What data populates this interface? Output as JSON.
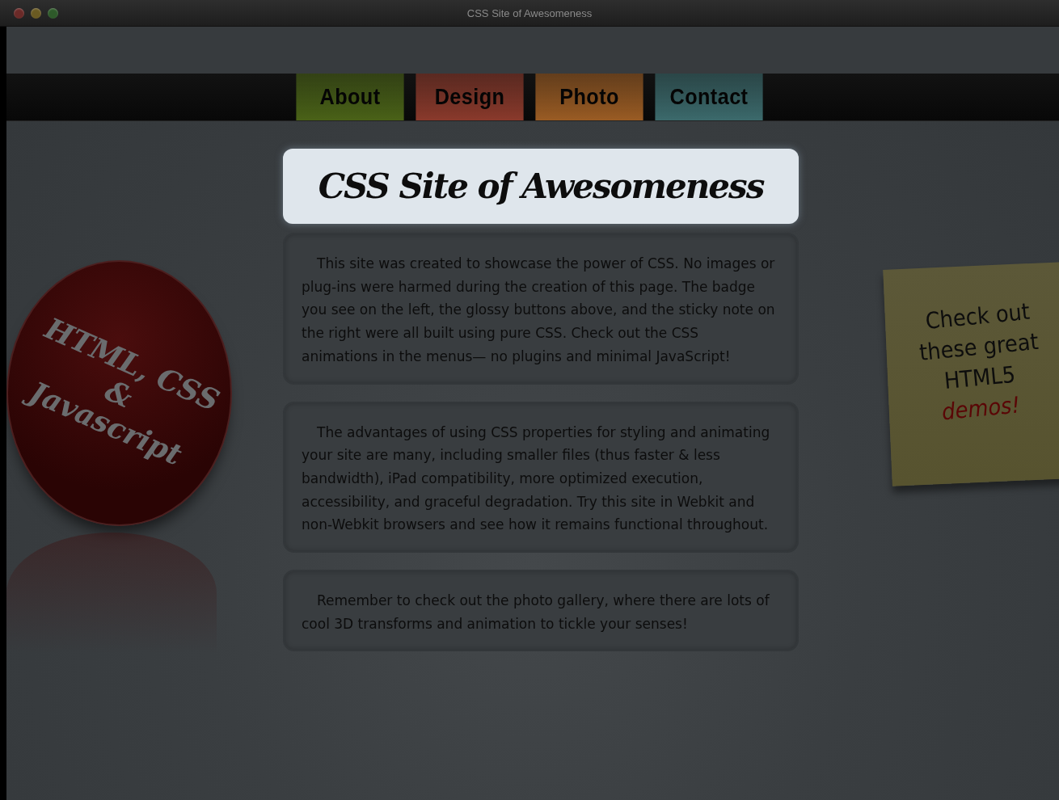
{
  "window": {
    "title": "CSS Site of Awesomeness"
  },
  "nav": [
    {
      "label": "About",
      "color": "#4a6218"
    },
    {
      "label": "Design",
      "color": "#8a3a2c"
    },
    {
      "label": "Photo",
      "color": "#9a5c24"
    },
    {
      "label": "Contact",
      "color": "#3c6a6c"
    }
  ],
  "header": {
    "title": "CSS Site of Awesomeness"
  },
  "badge": {
    "lines": [
      "HTML, CSS",
      "&",
      "Javascript"
    ]
  },
  "paragraphs": [
    "This site was created to showcase the power of CSS. No images or plug-ins were harmed during the creation of this page. The badge you see on the left, the glossy buttons above, and the sticky note on the right were all built using pure CSS. Check out the CSS animations in the menus— no plugins and minimal JavaScript!",
    "The advantages of using CSS properties for styling and animating your site are many, including smaller files (thus faster & less bandwidth), iPad compatibility, more optimized execution, accessibility, and graceful degradation. Try this site in Webkit and non-Webkit browsers and see how it remains functional throughout.",
    "Remember to check out the photo gallery, where there are lots of cool 3D transforms and animation to tickle your senses!"
  ],
  "sticky_note": {
    "lines": [
      {
        "text": "Check out",
        "kind": "plain"
      },
      {
        "text": "these great",
        "kind": "plain"
      },
      {
        "text": "HTML5",
        "kind": "plain"
      },
      {
        "text": "demos!",
        "kind": "emphasis"
      }
    ]
  }
}
